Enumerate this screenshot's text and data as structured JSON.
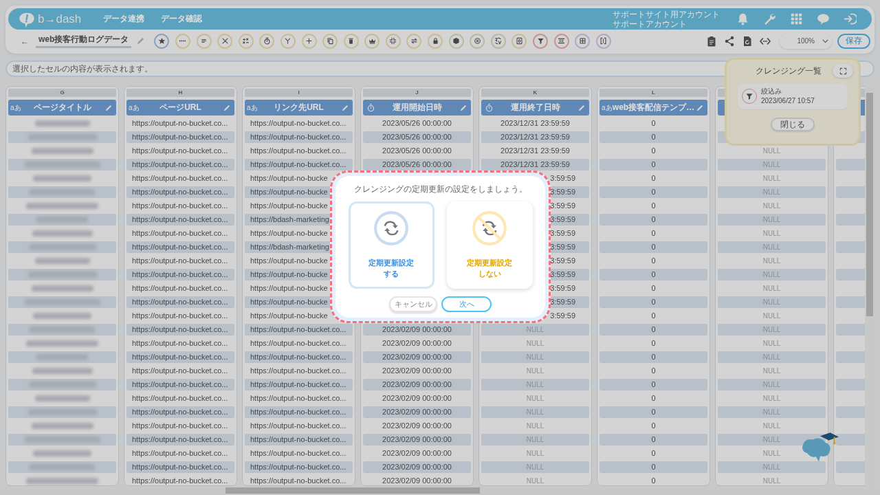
{
  "header": {
    "logo": "b→dash",
    "nav": [
      {
        "label": "データ連携"
      },
      {
        "label": "データ確認"
      }
    ],
    "account": [
      "サポートサイト用アカウント",
      "サポートアカウント"
    ],
    "icons": [
      {
        "kind": "bell"
      },
      {
        "kind": "wrench"
      },
      {
        "kind": "apps"
      },
      {
        "kind": "chat"
      },
      {
        "kind": "logout"
      }
    ]
  },
  "toolbar": {
    "back": "←",
    "title": "web接客行動ログデータ",
    "tools": [
      {
        "kind": "star",
        "color": "#8aa4bf"
      },
      {
        "kind": "more",
        "color": "#c7bc92"
      },
      {
        "kind": "lines",
        "color": "#c7bc92"
      },
      {
        "kind": "scissors",
        "color": "#c7bc92"
      },
      {
        "kind": "plusminus",
        "color": "#c7bc92"
      },
      {
        "kind": "stopwatch",
        "color": "#c7bc92"
      },
      {
        "kind": "branch",
        "color": "#c7bc92"
      },
      {
        "kind": "plus",
        "color": "#c7bc92"
      },
      {
        "kind": "copy",
        "color": "#c7bc92"
      },
      {
        "kind": "trash",
        "color": "#c7bc92"
      },
      {
        "kind": "crown",
        "color": "#c7bc92"
      },
      {
        "kind": "compress",
        "color": "#c7bc92"
      },
      {
        "kind": "swap",
        "color": "#c7bc92"
      },
      {
        "kind": "lock",
        "color": "#c7bc92"
      },
      {
        "kind": "box",
        "color": "#b2bd9f"
      },
      {
        "kind": "cancel",
        "color": "#b2bd9f"
      },
      {
        "kind": "translate",
        "color": "#b2bd9f"
      },
      {
        "kind": "counter",
        "color": "#c7bc92"
      },
      {
        "kind": "filter",
        "color": "#cb9292"
      },
      {
        "kind": "split",
        "color": "#cb9292"
      },
      {
        "kind": "grid",
        "color": "#b7a6c7"
      },
      {
        "kind": "bracket",
        "color": "#b7a6c7"
      }
    ],
    "actions": [
      {
        "kind": "clipboard"
      },
      {
        "kind": "share"
      },
      {
        "kind": "file"
      },
      {
        "kind": "code"
      }
    ],
    "zoom": "100%",
    "save": "保存"
  },
  "cell_preview": {
    "placeholder": "選択したセルの内容が表示されます。"
  },
  "table": {
    "columns": [
      {
        "letter": "G",
        "kind": "text",
        "badge": "aあ",
        "title": "ページタイトル",
        "cells": [
          {
            "kind": "redacted"
          },
          {
            "kind": "redacted"
          },
          {
            "kind": "redacted"
          },
          {
            "kind": "redacted"
          },
          {
            "kind": "redacted"
          },
          {
            "kind": "redacted"
          },
          {
            "kind": "redacted"
          },
          {
            "kind": "redacted"
          },
          {
            "kind": "redacted"
          },
          {
            "kind": "redacted"
          },
          {
            "kind": "redacted"
          },
          {
            "kind": "redacted"
          },
          {
            "kind": "redacted"
          },
          {
            "kind": "redacted"
          },
          {
            "kind": "redacted"
          },
          {
            "kind": "redacted"
          },
          {
            "kind": "redacted"
          },
          {
            "kind": "redacted"
          },
          {
            "kind": "redacted"
          },
          {
            "kind": "redacted"
          },
          {
            "kind": "redacted"
          },
          {
            "kind": "redacted"
          },
          {
            "kind": "redacted"
          },
          {
            "kind": "redacted"
          },
          {
            "kind": "redacted"
          },
          {
            "kind": "redacted"
          },
          {
            "kind": "redacted"
          }
        ]
      },
      {
        "letter": "H",
        "kind": "url",
        "badge": "aあ",
        "title": "ページURL",
        "cells": [
          "https://output-no-bucket.co...",
          "https://output-no-bucket.co...",
          "https://output-no-bucket.co...",
          "https://output-no-bucket.co...",
          "https://output-no-bucket.co...",
          "https://output-no-bucket.co...",
          "https://output-no-bucket.co...",
          "https://output-no-bucket.co...",
          "https://output-no-bucket.co...",
          "https://output-no-bucket.co...",
          "https://output-no-bucket.co...",
          "https://output-no-bucket.co...",
          "https://output-no-bucket.co...",
          "https://output-no-bucket.co...",
          "https://output-no-bucket.co...",
          "https://output-no-bucket.co...",
          "https://output-no-bucket.co...",
          "https://output-no-bucket.co...",
          "https://output-no-bucket.co...",
          "https://output-no-bucket.co...",
          "https://output-no-bucket.co...",
          "https://output-no-bucket.co...",
          "https://output-no-bucket.co...",
          "https://output-no-bucket.co...",
          "https://output-no-bucket.co...",
          "https://output-no-bucket.co...",
          "https://output-no-bucket.co..."
        ]
      },
      {
        "letter": "I",
        "kind": "url",
        "badge": "aあ",
        "title": "リンク先URL",
        "cells": [
          "https://output-no-bucket.co...",
          "https://output-no-bucket.co...",
          "https://output-no-bucket.co...",
          "https://output-no-bucket.co...",
          "https://output-no-bucke",
          "https://output-no-bucke",
          "https://output-no-bucke",
          "https://bdash-marketing",
          "https://output-no-bucke",
          "https://bdash-marketing",
          "https://output-no-bucke",
          "https://output-no-bucke",
          "https://output-no-bucke",
          "https://output-no-bucke",
          "https://output-no-bucke",
          "https://output-no-bucket.co...",
          "https://output-no-bucket.co...",
          "https://output-no-bucket.co...",
          "https://output-no-bucket.co...",
          "https://output-no-bucket.co...",
          "https://output-no-bucket.co...",
          "https://output-no-bucket.co...",
          "https://output-no-bucket.co...",
          "https://output-no-bucket.co...",
          "https://output-no-bucket.co...",
          "https://output-no-bucket.co...",
          "https://output-no-bucket.co..."
        ]
      },
      {
        "letter": "J",
        "kind": "datetime",
        "title": "運用開始日時",
        "cells": [
          "2023/05/26 00:00:00",
          "2023/05/26 00:00:00",
          "2023/05/26 00:00:00",
          "2023/05/26 00:00:00",
          null,
          null,
          null,
          null,
          null,
          null,
          null,
          null,
          null,
          null,
          null,
          "2023/02/09 00:00:00",
          "2023/02/09 00:00:00",
          "2023/02/09 00:00:00",
          "2023/02/09 00:00:00",
          "2023/02/09 00:00:00",
          "2023/02/09 00:00:00",
          "2023/02/09 00:00:00",
          "2023/02/09 00:00:00",
          "2023/02/09 00:00:00",
          "2023/02/09 00:00:00",
          "2023/02/09 00:00:00",
          "2023/02/09 00:00:00"
        ]
      },
      {
        "letter": "K",
        "kind": "datetime",
        "title": "運用終了日時",
        "cells": [
          "2023/12/31 23:59:59",
          "2023/12/31 23:59:59",
          "2023/12/31 23:59:59",
          "2023/12/31 23:59:59",
          {
            "text": "3:59:59",
            "cut": true
          },
          {
            "text": "3:59:59",
            "cut": true
          },
          {
            "text": "3:59:59",
            "cut": true
          },
          {
            "text": "3:59:59",
            "cut": true
          },
          {
            "text": "3:59:59",
            "cut": true
          },
          {
            "text": "3:59:59",
            "cut": true
          },
          {
            "text": "3:59:59",
            "cut": true
          },
          {
            "text": "3:59:59",
            "cut": true
          },
          {
            "text": "3:59:59",
            "cut": true
          },
          {
            "text": "3:59:59",
            "cut": true
          },
          {
            "text": "3:59:59",
            "cut": true
          },
          {
            "text": "NULL",
            "kind": "null"
          },
          {
            "text": "NULL",
            "kind": "null"
          },
          {
            "text": "NULL",
            "kind": "null"
          },
          {
            "text": "NULL",
            "kind": "null"
          },
          {
            "text": "NULL",
            "kind": "null"
          },
          {
            "text": "NULL",
            "kind": "null"
          },
          {
            "text": "NULL",
            "kind": "null"
          },
          {
            "text": "NULL",
            "kind": "null"
          },
          {
            "text": "NULL",
            "kind": "null"
          },
          {
            "text": "NULL",
            "kind": "null"
          },
          {
            "text": "NULL",
            "kind": "null"
          },
          {
            "text": "NULL",
            "kind": "null"
          }
        ]
      },
      {
        "letter": "L",
        "kind": "text",
        "badge": "aあ",
        "title": "web接客配信テンプ…",
        "cells": [
          "0",
          "0",
          "0",
          "0",
          "0",
          "0",
          "0",
          "0",
          "0",
          "0",
          "0",
          "0",
          "0",
          "0",
          "0",
          "0",
          "0",
          "0",
          "0",
          "0",
          "0",
          "0",
          "0",
          "0",
          "0",
          "0",
          "0"
        ]
      },
      {
        "kind": "text",
        "cells": [
          null,
          null,
          {
            "text": "NULL",
            "kind": "null"
          },
          {
            "text": "NULL",
            "kind": "null"
          },
          {
            "text": "NULL",
            "kind": "null"
          },
          {
            "text": "NULL",
            "kind": "null"
          },
          {
            "text": "NULL",
            "kind": "null"
          },
          {
            "text": "NULL",
            "kind": "null"
          },
          {
            "text": "NULL",
            "kind": "null"
          },
          {
            "text": "NULL",
            "kind": "null"
          },
          {
            "text": "NULL",
            "kind": "null"
          },
          {
            "text": "NULL",
            "kind": "null"
          },
          {
            "text": "NULL",
            "kind": "null"
          },
          {
            "text": "NULL",
            "kind": "null"
          },
          {
            "text": "NULL",
            "kind": "null"
          },
          {
            "text": "NULL",
            "kind": "null"
          },
          {
            "text": "NULL",
            "kind": "null"
          },
          {
            "text": "NULL",
            "kind": "null"
          },
          {
            "text": "NULL",
            "kind": "null"
          },
          {
            "text": "NULL",
            "kind": "null"
          },
          {
            "text": "NULL",
            "kind": "null"
          },
          {
            "text": "NULL",
            "kind": "null"
          },
          {
            "text": "NULL",
            "kind": "null"
          },
          {
            "text": "NULL",
            "kind": "null"
          },
          {
            "text": "NULL",
            "kind": "null"
          },
          {
            "text": "NULL",
            "kind": "null"
          },
          {
            "text": "NULL",
            "kind": "null"
          }
        ]
      },
      {
        "kind": "text",
        "cells": [
          null,
          null,
          null,
          null,
          null,
          null,
          null,
          null,
          null,
          null,
          null,
          null,
          null,
          null,
          null,
          null,
          null,
          null,
          null,
          null,
          null,
          null,
          null,
          null,
          null,
          null,
          null
        ]
      }
    ]
  },
  "cleansing_panel": {
    "title": "クレンジング一覧",
    "items": [
      {
        "kind": "filter",
        "label": "絞込み",
        "time": "2023/06/27 10:57"
      }
    ],
    "close": "閉じる"
  },
  "dialog": {
    "message": "クレンジングの定期更新の設定をしましょう。",
    "options": [
      {
        "kind": "on",
        "lines": [
          "定期更新設定",
          "する"
        ],
        "selected": true
      },
      {
        "kind": "off",
        "lines": [
          "定期更新設定",
          "しない"
        ],
        "selected": false
      }
    ],
    "buttons": [
      {
        "kind": "cancel",
        "label": "キャンセル"
      },
      {
        "kind": "primary",
        "label": "次へ"
      }
    ]
  }
}
